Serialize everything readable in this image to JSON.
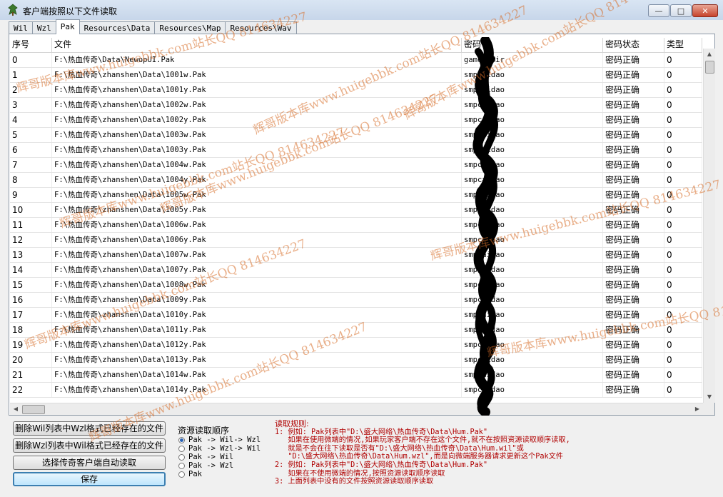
{
  "window": {
    "title": "客户端按照以下文件读取",
    "min_label": "—",
    "max_label": "□",
    "close_label": "✕"
  },
  "tabs": [
    {
      "label": "Wil",
      "active": false
    },
    {
      "label": "Wzl",
      "active": false
    },
    {
      "label": "Pak",
      "active": true
    },
    {
      "label": "Resources\\Data",
      "active": false
    },
    {
      "label": "Resources\\Map",
      "active": false
    },
    {
      "label": "Resources\\Wav",
      "active": false
    }
  ],
  "table": {
    "columns": [
      "序号",
      "文件",
      "密码",
      "密码状态",
      "类型"
    ],
    "rows": [
      {
        "index": "0",
        "file": "F:\\热血传奇\\Data\\NewopUI.Pak",
        "password": "gameofmir",
        "status": "密码正确",
        "type": "0"
      },
      {
        "index": "1",
        "file": "F:\\热血传奇\\zhanshen\\Data\\1001w.Pak",
        "password": "smpcaidao",
        "status": "密码正确",
        "type": "0"
      },
      {
        "index": "2",
        "file": "F:\\热血传奇\\zhanshen\\Data\\1001y.Pak",
        "password": "smpcaidao",
        "status": "密码正确",
        "type": "0"
      },
      {
        "index": "3",
        "file": "F:\\热血传奇\\zhanshen\\Data\\1002w.Pak",
        "password": "smpcaidao",
        "status": "密码正确",
        "type": "0"
      },
      {
        "index": "4",
        "file": "F:\\热血传奇\\zhanshen\\Data\\1002y.Pak",
        "password": "smpcaidao",
        "status": "密码正确",
        "type": "0"
      },
      {
        "index": "5",
        "file": "F:\\热血传奇\\zhanshen\\Data\\1003w.Pak",
        "password": "smpcaidao",
        "status": "密码正确",
        "type": "0"
      },
      {
        "index": "6",
        "file": "F:\\热血传奇\\zhanshen\\Data\\1003y.Pak",
        "password": "smpcaidao",
        "status": "密码正确",
        "type": "0"
      },
      {
        "index": "7",
        "file": "F:\\热血传奇\\zhanshen\\Data\\1004w.Pak",
        "password": "smpcaidao",
        "status": "密码正确",
        "type": "0"
      },
      {
        "index": "8",
        "file": "F:\\热血传奇\\zhanshen\\Data\\1004y.Pak",
        "password": "smpcaidao",
        "status": "密码正确",
        "type": "0"
      },
      {
        "index": "9",
        "file": "F:\\热血传奇\\zhanshen\\Data\\1005w.Pak",
        "password": "smpcaidao",
        "status": "密码正确",
        "type": "0"
      },
      {
        "index": "10",
        "file": "F:\\热血传奇\\zhanshen\\Data\\1005y.Pak",
        "password": "smpcaidao",
        "status": "密码正确",
        "type": "0"
      },
      {
        "index": "11",
        "file": "F:\\热血传奇\\zhanshen\\Data\\1006w.Pak",
        "password": "smpcaidao",
        "status": "密码正确",
        "type": "0"
      },
      {
        "index": "12",
        "file": "F:\\热血传奇\\zhanshen\\Data\\1006y.Pak",
        "password": "smpcaidao",
        "status": "密码正确",
        "type": "0"
      },
      {
        "index": "13",
        "file": "F:\\热血传奇\\zhanshen\\Data\\1007w.Pak",
        "password": "smpcaidao",
        "status": "密码正确",
        "type": "0"
      },
      {
        "index": "14",
        "file": "F:\\热血传奇\\zhanshen\\Data\\1007y.Pak",
        "password": "smpcaidao",
        "status": "密码正确",
        "type": "0"
      },
      {
        "index": "15",
        "file": "F:\\热血传奇\\zhanshen\\Data\\1008w.Pak",
        "password": "smpcaidao",
        "status": "密码正确",
        "type": "0"
      },
      {
        "index": "16",
        "file": "F:\\热血传奇\\zhanshen\\Data\\1009y.Pak",
        "password": "smpcaidao",
        "status": "密码正确",
        "type": "0"
      },
      {
        "index": "17",
        "file": "F:\\热血传奇\\zhanshen\\Data\\1010y.Pak",
        "password": "smpcaidao",
        "status": "密码正确",
        "type": "0"
      },
      {
        "index": "18",
        "file": "F:\\热血传奇\\zhanshen\\Data\\1011y.Pak",
        "password": "smpcaidao",
        "status": "密码正确",
        "type": "0"
      },
      {
        "index": "19",
        "file": "F:\\热血传奇\\zhanshen\\Data\\1012y.Pak",
        "password": "smpcaidao",
        "status": "密码正确",
        "type": "0"
      },
      {
        "index": "20",
        "file": "F:\\热血传奇\\zhanshen\\Data\\1013y.Pak",
        "password": "smpcaidao",
        "status": "密码正确",
        "type": "0"
      },
      {
        "index": "21",
        "file": "F:\\热血传奇\\zhanshen\\Data\\1014w.Pak",
        "password": "smpcaidao",
        "status": "密码正确",
        "type": "0"
      },
      {
        "index": "22",
        "file": "F:\\热血传奇\\zhanshen\\Data\\1014y.Pak",
        "password": "smpcaidao",
        "status": "密码正确",
        "type": "0"
      }
    ]
  },
  "buttons": {
    "delete_wil": "删除Wil列表中Wzl格式已经存在的文件",
    "delete_wzl": "删除Wzl列表中Wil格式已经存在的文件",
    "auto_read": "选择传奇客户端自动读取",
    "save": "保存"
  },
  "read_order": {
    "title": "资源读取顺序",
    "options": [
      {
        "label": "Pak -> Wil-> Wzl",
        "checked": true
      },
      {
        "label": "Pak -> Wzl-> Wil",
        "checked": false
      },
      {
        "label": "Pak -> Wil",
        "checked": false
      },
      {
        "label": "Pak -> Wzl",
        "checked": false
      },
      {
        "label": "Pak",
        "checked": false
      }
    ]
  },
  "rules": {
    "title": "读取规则:",
    "lines": [
      "1: 例如: Pak列表中\"D:\\盛大网络\\热血传奇\\Data\\Hum.Pak\"",
      "   如果在使用微端的情况,如果玩家客户端不存在这个文件,就不在按照资源读取顺序读取,",
      "   就是不会在往下读取是否有\"D:\\盛大网络\\热血传奇\\Data\\Hum.wil\"或",
      "   \"D:\\盛大网络\\热血传奇\\Data\\Hum.wzl\",而是向微端服务器请求更新这个Pak文件",
      "2: 例如: Pak列表中\"D:\\盛大网络\\热血传奇\\Data\\Hum.Pak\"",
      "   如果在不使用微端的情况,按照资源读取顺序读取",
      "3: 上面列表中没有的文件按照资源读取顺序读取"
    ]
  },
  "watermarks": [
    "辉哥版本库www.huigebbk.com站长QQ 814634227",
    "辉哥版本库www.huigebbk.com站长QQ 814634227",
    "辉哥版本库www.huigebbk.com站长QQ 814634227",
    "辉哥版本库www.huigebbk.com站长QQ 814634227",
    "辉哥版本库www.huigebbk.com站长QQ 814634227",
    "辉哥版本库www.huigebbk.com站长QQ 814634227",
    "辉哥版本库www.huigebbk.com站长QQ 814634227",
    "辉哥版本库www.huigebbk.com站长QQ 814634227",
    "辉哥版本库www.huigebbk.com站长QQ 814634227"
  ],
  "colors": {
    "rules_text": "#b00000",
    "selected_tab": "#ffffff",
    "watermark": "#d76e28"
  }
}
